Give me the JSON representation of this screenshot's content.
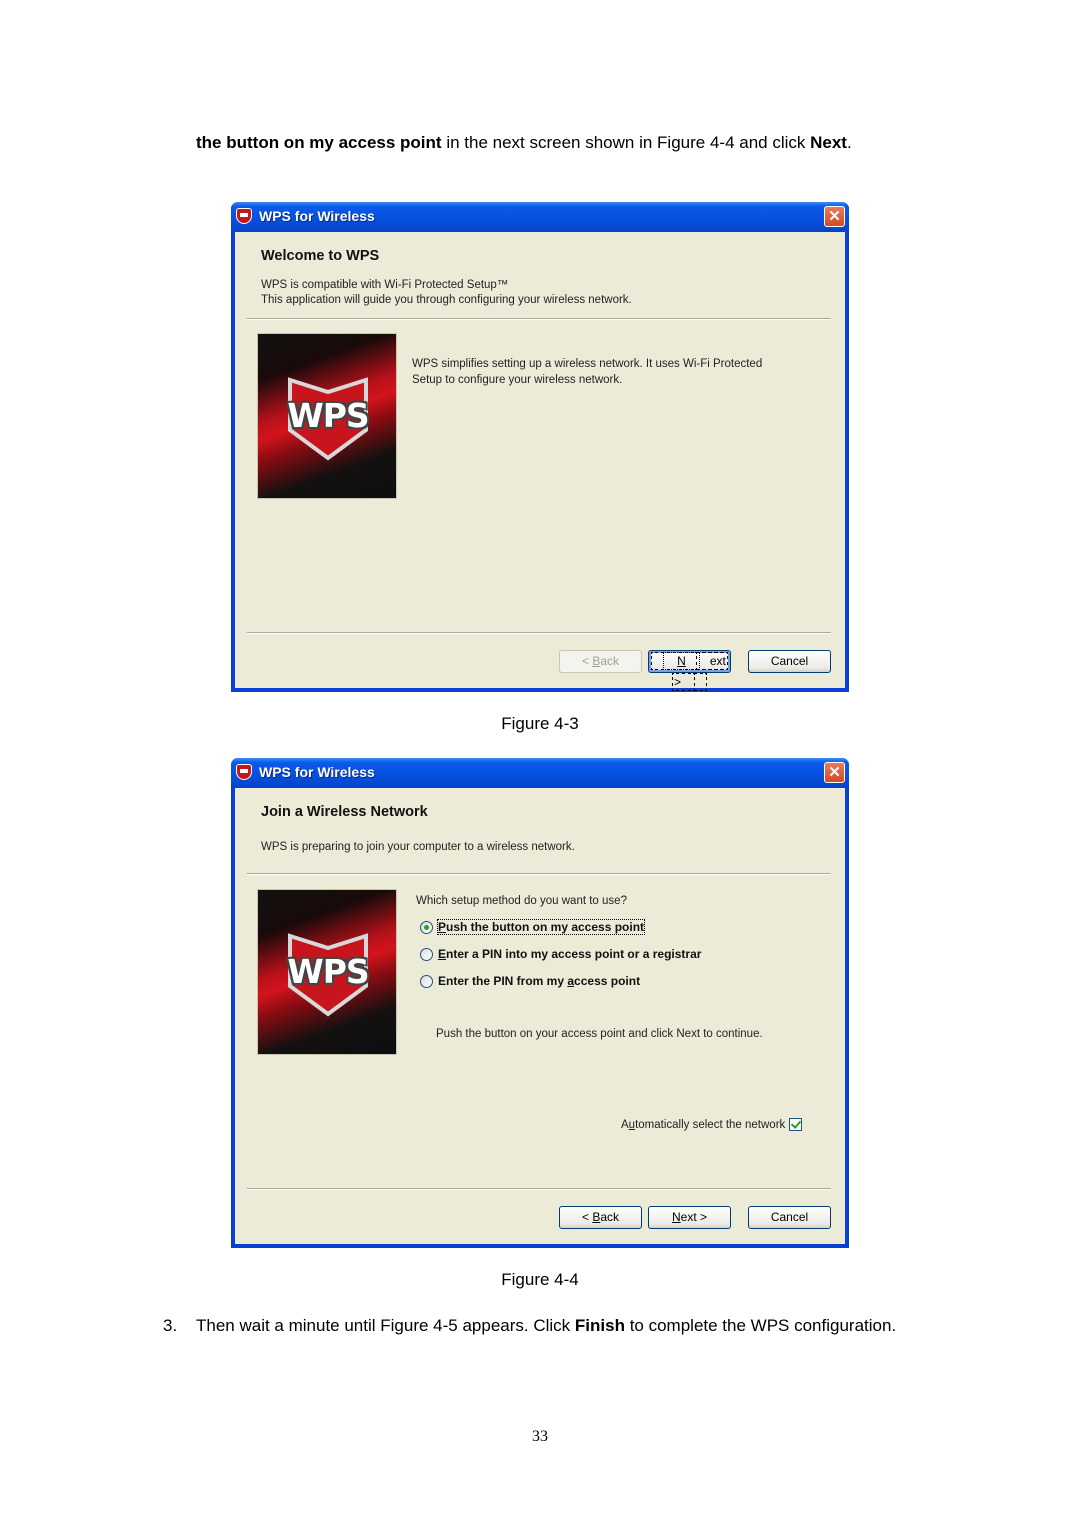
{
  "intro": {
    "bold_lead": "the button on my access point",
    "text_mid": " in the next screen shown in Figure 4-4 and click ",
    "bold_end": "Next",
    "text_end": "."
  },
  "figure3": {
    "caption": "Figure 4-3",
    "window": {
      "title": "WPS for Wireless",
      "close_glyph": "✕",
      "heading": "Welcome to WPS",
      "subtext_line1": "WPS is compatible with Wi-Fi Protected Setup™",
      "subtext_line2": "This application will guide you through configuring your wireless network.",
      "logo_text": "WPS",
      "description_line1": "WPS simplifies setting up a wireless network. It uses Wi-Fi Protected",
      "description_line2": "Setup to configure your wireless network.",
      "buttons": {
        "back": {
          "pre": "< ",
          "accel": "B",
          "post": "ack",
          "enabled": false
        },
        "next": {
          "accel": "N",
          "post": "ext >",
          "enabled": true,
          "default": true
        },
        "cancel": {
          "label": "Cancel",
          "enabled": true
        }
      }
    }
  },
  "figure4": {
    "caption": "Figure 4-4",
    "window": {
      "title": "WPS for Wireless",
      "close_glyph": "✕",
      "heading": "Join a Wireless Network",
      "subtext": "WPS is preparing to join your computer to a wireless network.",
      "logo_text": "WPS",
      "question": "Which setup method do you want to use?",
      "options": [
        {
          "accel": "P",
          "rest": "ush the button on my access point",
          "checked": true
        },
        {
          "accel": "E",
          "rest": "nter a PIN into my access point or a registrar",
          "checked": false
        },
        {
          "pre": "Enter the PIN from my ",
          "accel": "a",
          "rest": "ccess point",
          "checked": false
        }
      ],
      "instruction": "Push the button on your access point and click Next to continue.",
      "auto_select": {
        "pre": "A",
        "accel": "u",
        "rest": "tomatically select the network",
        "checked": true
      },
      "buttons": {
        "back": {
          "pre": "< ",
          "accel": "B",
          "post": "ack",
          "enabled": true
        },
        "next": {
          "accel": "N",
          "post": "ext >",
          "enabled": true
        },
        "cancel": {
          "label": "Cancel",
          "enabled": true
        }
      }
    }
  },
  "step3": {
    "number": "3.",
    "text_a": "Then wait a minute until Figure 4-5 appears. Click ",
    "bold": "Finish",
    "text_b": " to complete the WPS configuration."
  },
  "page_number": "33"
}
